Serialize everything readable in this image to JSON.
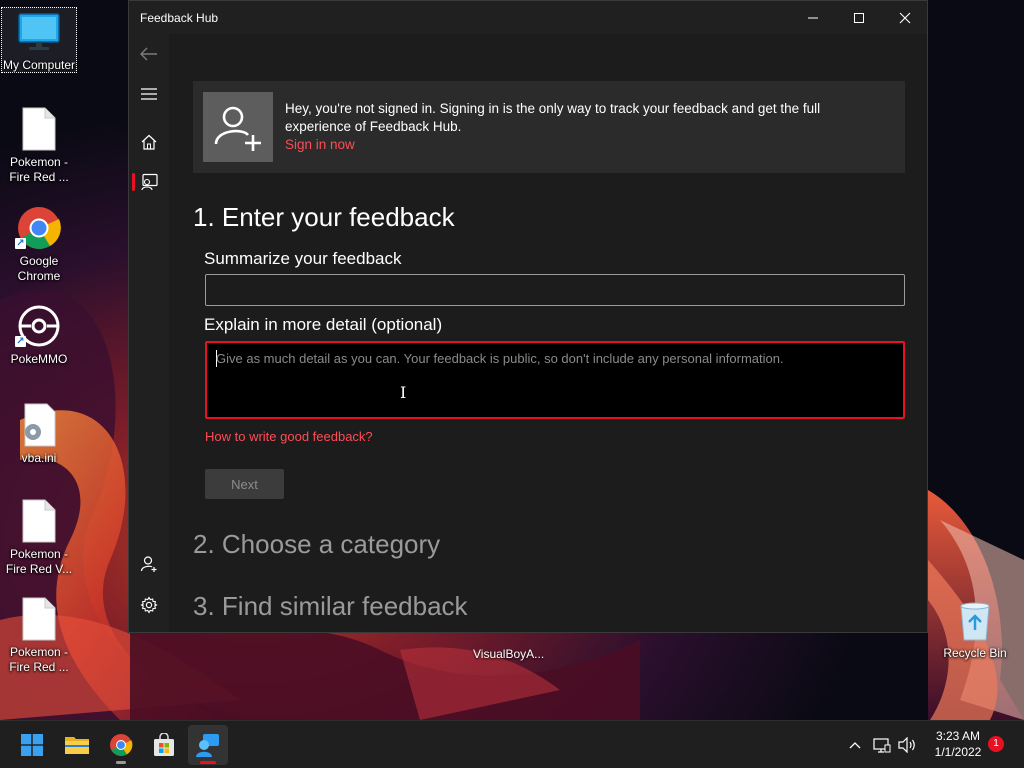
{
  "desktop": {
    "icons": [
      {
        "label": "My Computer"
      },
      {
        "label": "Pokemon - Fire Red ..."
      },
      {
        "label": "Google Chrome"
      },
      {
        "label": "PokeMMO"
      },
      {
        "label": "vba.ini"
      },
      {
        "label": "Pokemon - Fire Red V..."
      },
      {
        "label": "Pokemon - Fire Red ..."
      }
    ],
    "visualboy_label": "VisualBoyA...",
    "recycle_bin_label": "Recycle Bin"
  },
  "window": {
    "title": "Feedback Hub",
    "banner": {
      "message": "Hey, you're not signed in. Signing in is the only way to track your feedback and get the full experience of Feedback Hub.",
      "signin_link": "Sign in now"
    },
    "step1_heading": "1. Enter your feedback",
    "summary_label": "Summarize your feedback",
    "summary_value": "",
    "detail_label": "Explain in more detail (optional)",
    "detail_placeholder": "Give as much detail as you can. Your feedback is public, so don't include any personal information.",
    "help_link": "How to write good feedback?",
    "next_button": "Next",
    "step2_heading": "2. Choose a category",
    "step3_heading": "3. Find similar feedback"
  },
  "taskbar": {
    "clock_time": "3:23 AM",
    "clock_date": "1/1/2022",
    "notification_count": "1"
  },
  "colors": {
    "accent": "#e81123",
    "link": "#ff4c57",
    "window_bg": "#202020",
    "content_bg": "#1c1c1c"
  }
}
